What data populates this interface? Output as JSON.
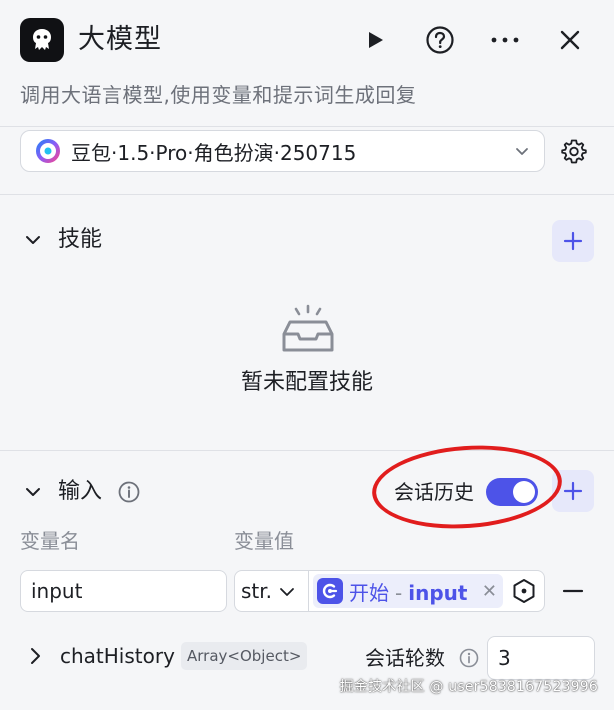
{
  "header": {
    "title": "大模型",
    "subtitle": "调用大语言模型,使用变量和提示词生成回复",
    "icons": {
      "logo": "bot-logo-icon",
      "run": "play-icon",
      "help": "help-circle-icon",
      "more": "more-dots-icon",
      "close": "close-icon"
    }
  },
  "model": {
    "selected": "豆包·1.5·Pro·角色扮演·250715",
    "icon": "doubao-model-icon"
  },
  "skills": {
    "title": "技能",
    "empty_text": "暂未配置技能"
  },
  "inputs": {
    "title": "输入",
    "history_label": "会话历史",
    "history_enabled": true,
    "col_name": "变量名",
    "col_value": "变量值",
    "rows": [
      {
        "name": "input",
        "type": "str.",
        "ref_node": "开始",
        "ref_sep": "-",
        "ref_var": "input"
      }
    ],
    "chat_history": {
      "name": "chatHistory",
      "type_badge": "Array<Object>",
      "turns_label": "会话轮数",
      "turns_value": "3"
    }
  },
  "colors": {
    "accent": "#4d53e8",
    "annotation": "#e11d1d"
  },
  "watermark": "掘金技术社区 @ user5838167523996"
}
